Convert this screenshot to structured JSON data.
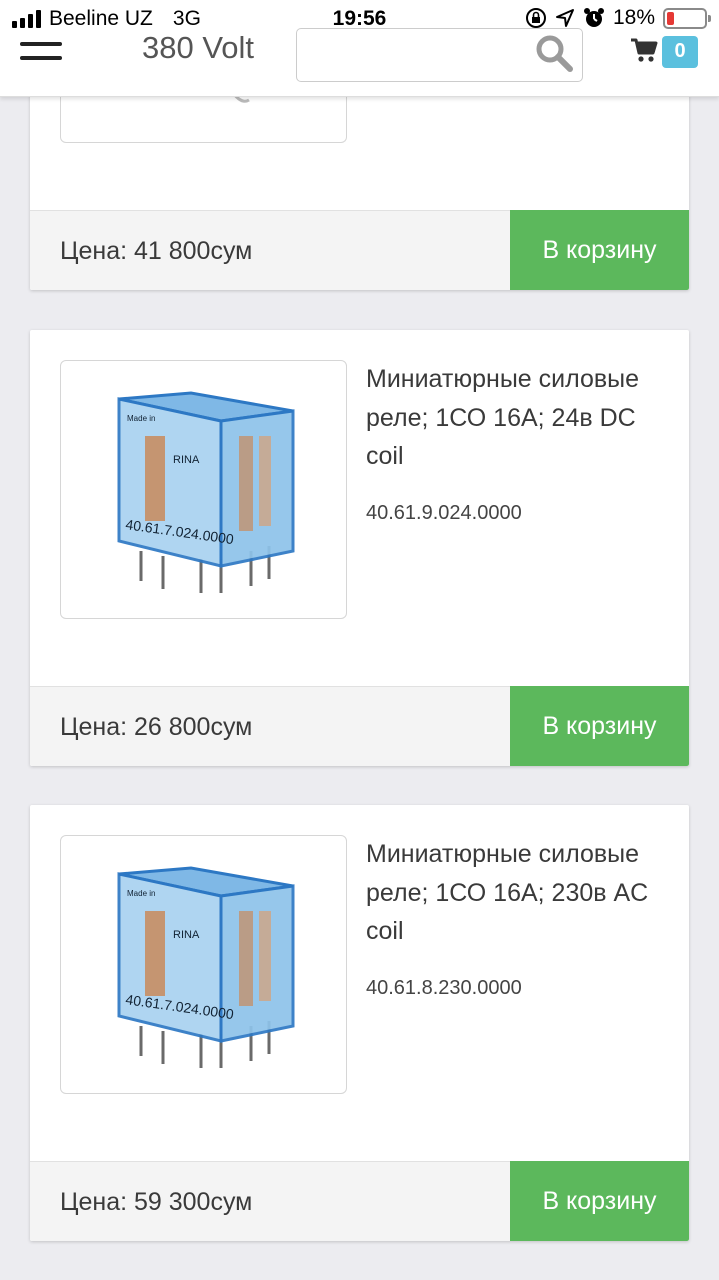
{
  "status_bar": {
    "carrier": "Beeline UZ",
    "network": "3G",
    "time": "19:56",
    "battery": "18%"
  },
  "header": {
    "brand": "380 Volt",
    "search_placeholder": "",
    "cart_count": "0"
  },
  "products": [
    {
      "title": "",
      "sku": "",
      "price": "Цена: 41 800сум",
      "button": "В корзину"
    },
    {
      "title": "Миниатюрные силовые реле; 1СО 16А; 24в DC coil",
      "sku": "40.61.9.024.0000",
      "price": "Цена: 26 800сум",
      "button": "В корзину"
    },
    {
      "title": "Миниатюрные силовые реле; 1СО 16А; 230в AC coil",
      "sku": "40.61.8.230.0000",
      "price": "Цена: 59 300сум",
      "button": "В корзину"
    }
  ],
  "colors": {
    "cart_button": "#5cb85c",
    "cart_badge": "#5bc0de",
    "page_background": "#ececf0"
  }
}
